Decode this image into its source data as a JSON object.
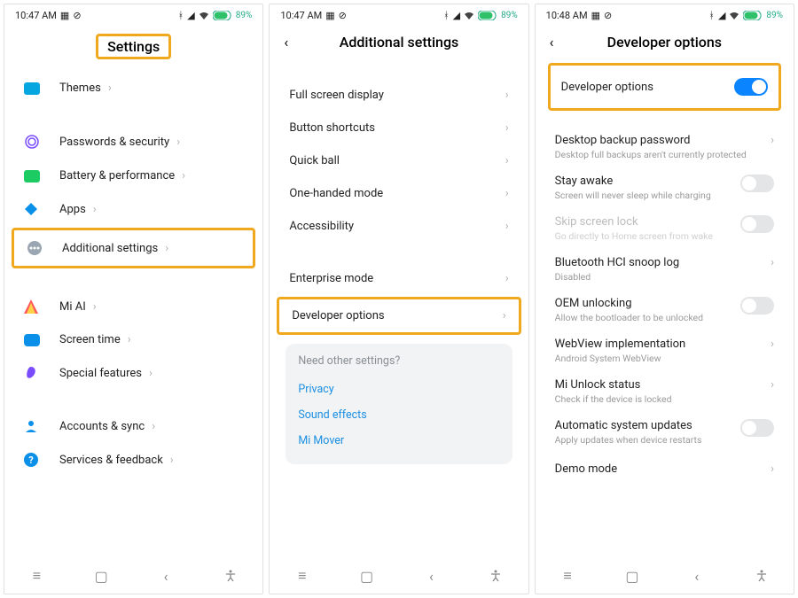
{
  "statusbar": {
    "time1": "10:47 AM",
    "time2": "10:47 AM",
    "time3": "10:48 AM",
    "battery": "89%"
  },
  "screen1": {
    "title": "Settings",
    "items": {
      "themes": "Themes",
      "passwords": "Passwords & security",
      "battery": "Battery & performance",
      "apps": "Apps",
      "additional": "Additional settings",
      "miai": "Mi AI",
      "screentime": "Screen time",
      "special": "Special features",
      "accounts": "Accounts & sync",
      "services": "Services & feedback"
    }
  },
  "screen2": {
    "title": "Additional settings",
    "items": {
      "fullscreen": "Full screen display",
      "buttons": "Button shortcuts",
      "quickball": "Quick ball",
      "onehand": "One-handed mode",
      "accessibility": "Accessibility",
      "enterprise": "Enterprise mode",
      "developer": "Developer options"
    },
    "card": {
      "title": "Need other settings?",
      "privacy": "Privacy",
      "sound": "Sound effects",
      "mimover": "Mi Mover"
    }
  },
  "screen3": {
    "title": "Developer options",
    "master": "Developer options",
    "items": {
      "backup": {
        "label": "Desktop backup password",
        "sub": "Desktop full backups aren't currently protected"
      },
      "stay": {
        "label": "Stay awake",
        "sub": "Screen will never sleep while charging"
      },
      "skip": {
        "label": "Skip screen lock",
        "sub": "Go directly to Home screen from wake"
      },
      "hci": {
        "label": "Bluetooth HCI snoop log",
        "sub": "Disabled"
      },
      "oem": {
        "label": "OEM unlocking",
        "sub": "Allow the bootloader to be unlocked"
      },
      "webview": {
        "label": "WebView implementation",
        "sub": "Android System WebView"
      },
      "miunlock": {
        "label": "Mi Unlock status",
        "sub": "Check if the device is locked"
      },
      "autoupd": {
        "label": "Automatic system updates",
        "sub": "Apply updates when device restarts"
      },
      "demo": {
        "label": "Demo mode",
        "sub": ""
      }
    }
  }
}
